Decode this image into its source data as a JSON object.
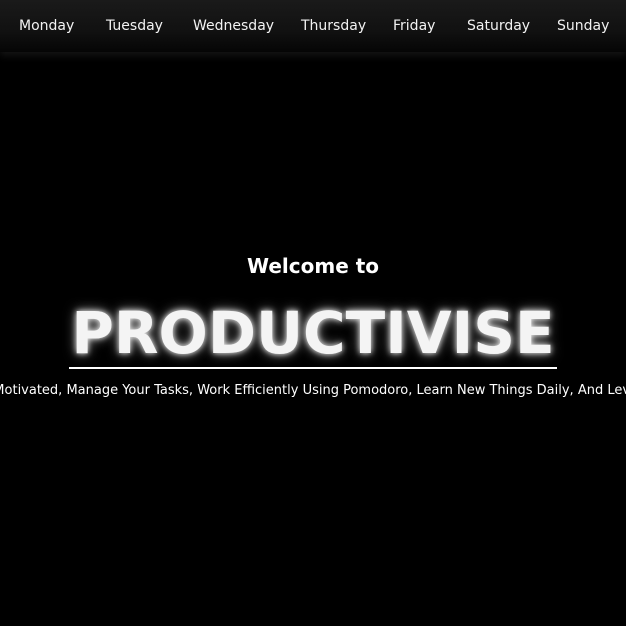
{
  "nav": {
    "days": [
      "Monday",
      "Tuesday",
      "Wednesday",
      "Thursday",
      "Friday",
      "Saturday",
      "Sunday"
    ]
  },
  "hero": {
    "welcome": "Welcome to",
    "brand": "PRODUCTIVISE",
    "tagline": "Get Motivated, Manage Your Tasks, Work Efficiently Using Pomodoro, Learn New Things Daily, And Level Up With"
  },
  "colors": {
    "background": "#000000",
    "text": "#ffffff",
    "nav_background": "#111111"
  }
}
